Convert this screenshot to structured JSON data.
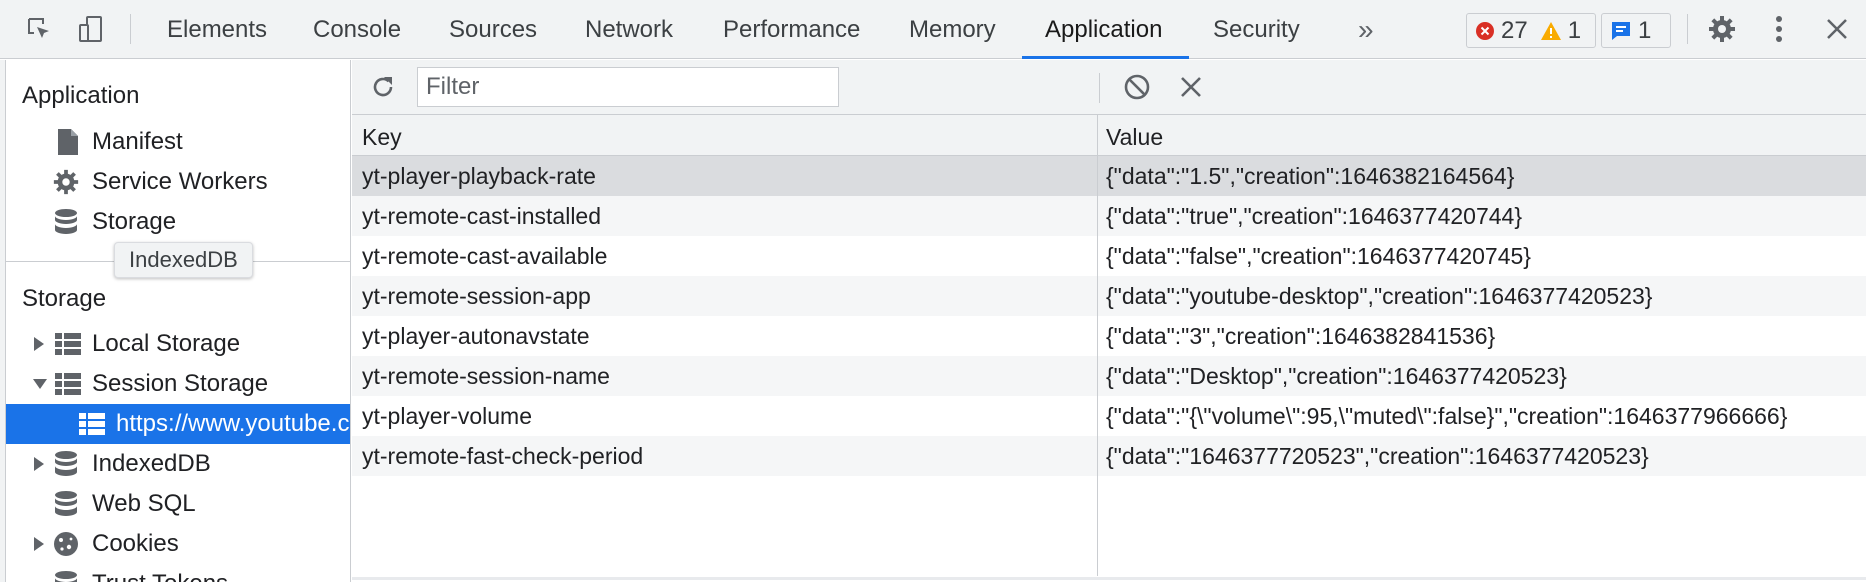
{
  "toolbar": {
    "tabs": [
      "Elements",
      "Console",
      "Sources",
      "Network",
      "Performance",
      "Memory",
      "Application",
      "Security"
    ],
    "active_tab": "Application",
    "more_tabs": "»",
    "errors_count": "27",
    "warnings_count": "1",
    "messages_count": "1"
  },
  "sidebar": {
    "app_heading": "Application",
    "app_items": [
      "Manifest",
      "Service Workers",
      "Storage"
    ],
    "tooltip": "IndexedDB",
    "storage_heading": "Storage",
    "storage_items": {
      "local_storage": "Local Storage",
      "session_storage": "Session Storage",
      "session_origin": "https://www.youtube.com",
      "indexeddb": "IndexedDB",
      "websql": "Web SQL",
      "cookies": "Cookies",
      "trust_tokens": "Trust Tokens"
    }
  },
  "filter": {
    "placeholder": "Filter"
  },
  "grid": {
    "headers": {
      "key": "Key",
      "value": "Value"
    },
    "rows": [
      {
        "key": "yt-player-playback-rate",
        "value": "{\"data\":\"1.5\",\"creation\":1646382164564}"
      },
      {
        "key": "yt-remote-cast-installed",
        "value": "{\"data\":\"true\",\"creation\":1646377420744}"
      },
      {
        "key": "yt-remote-cast-available",
        "value": "{\"data\":\"false\",\"creation\":1646377420745}"
      },
      {
        "key": "yt-remote-session-app",
        "value": "{\"data\":\"youtube-desktop\",\"creation\":1646377420523}"
      },
      {
        "key": "yt-player-autonavstate",
        "value": "{\"data\":\"3\",\"creation\":1646382841536}"
      },
      {
        "key": "yt-remote-session-name",
        "value": "{\"data\":\"Desktop\",\"creation\":1646377420523}"
      },
      {
        "key": "yt-player-volume",
        "value": "{\"data\":\"{\\\"volume\\\":95,\\\"muted\\\":false}\",\"creation\":1646377966666}"
      },
      {
        "key": "yt-remote-fast-check-period",
        "value": "{\"data\":\"1646377720523\",\"creation\":1646377420523}"
      }
    ]
  },
  "colors": {
    "accent": "#1a73e8",
    "error": "#d93025",
    "warning": "#f9ab00",
    "info": "#1a73e8"
  }
}
